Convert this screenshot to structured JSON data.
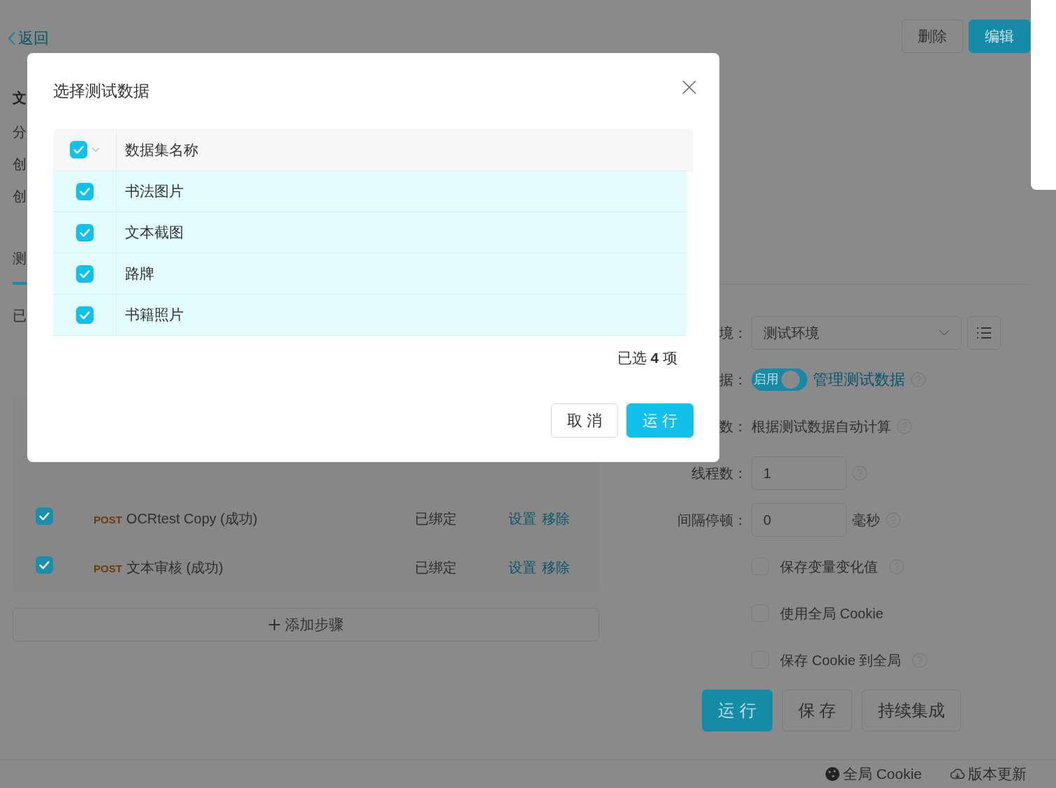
{
  "header": {
    "back_link": "返回",
    "buttons": [
      {
        "label": "删除",
        "kind": "default"
      },
      {
        "label": "编辑",
        "kind": "primary"
      }
    ]
  },
  "detail": {
    "title": "文",
    "meta": [
      "分",
      "创",
      "创"
    ],
    "tab": {
      "label": "测",
      "selected": true
    },
    "summary": "已"
  },
  "steps": [
    {
      "method": "POST",
      "kind": "post",
      "name": "OCRtest Copy (成功)",
      "checked": true,
      "status": "已绑定",
      "actions": [
        "设置",
        "移除"
      ]
    },
    {
      "method": "POST",
      "kind": "post",
      "name": "文本审核 (成功)",
      "checked": true,
      "status": "已绑定",
      "actions": [
        "设置",
        "移除"
      ]
    }
  ],
  "add_step": "添加步骤",
  "run_form": {
    "environment": {
      "label": "境：",
      "value": "测试环境"
    },
    "test_data": {
      "label": "据：",
      "on": true,
      "switch_text": "启用",
      "link": "管理测试数据"
    },
    "iterations": {
      "label": "数：",
      "value": "根据测试数据自动计算"
    },
    "threads": {
      "label": "线程数：",
      "value": "1"
    },
    "interval": {
      "label": "间隔停顿：",
      "value": "0",
      "unit": "毫秒"
    },
    "options": [
      {
        "label": "保存变量变化值",
        "checked": false,
        "help": true
      },
      {
        "label": "使用全局 Cookie",
        "checked": false,
        "help": false
      },
      {
        "label": "保存 Cookie 到全局",
        "checked": false,
        "help": true
      }
    ],
    "buttons": [
      {
        "label": "运 行",
        "kind": "primary"
      },
      {
        "label": "保 存",
        "kind": "default"
      },
      {
        "label": "持续集成",
        "kind": "default"
      }
    ]
  },
  "footer": [
    {
      "label": "全局 Cookie",
      "kind": "cookie"
    },
    {
      "label": "版本更新",
      "kind": "cloud"
    }
  ],
  "modal": {
    "title": "选择测试数据",
    "column": "数据集名称",
    "all_checked": true,
    "rows": [
      {
        "name": "书法图片",
        "checked": true
      },
      {
        "name": "文本截图",
        "checked": true
      },
      {
        "name": "路牌",
        "checked": true
      },
      {
        "name": "书籍照片",
        "checked": true
      }
    ],
    "summary": "已选 **4** 项",
    "buttons": [
      {
        "label": "取 消",
        "kind": "default"
      },
      {
        "label": "运 行",
        "kind": "primary"
      }
    ]
  }
}
